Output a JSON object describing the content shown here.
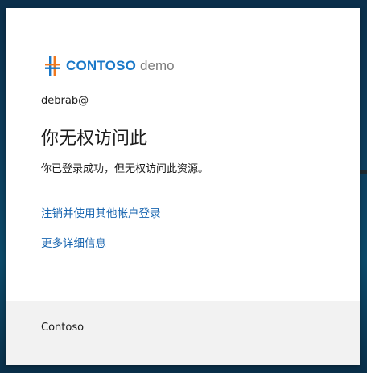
{
  "logo": {
    "brand": "CONTOSO",
    "suffix": "demo",
    "icon": "contoso-logo-icon",
    "colors": {
      "brand": "#1a78c8",
      "accent": "#f0781e"
    }
  },
  "identity": {
    "user": "debrab@"
  },
  "message": {
    "title": "你无权访问此",
    "description": "你已登录成功，但无权访问此资源。"
  },
  "links": {
    "sign_out_other": "注销并使用其他帐户登录",
    "more_details": "更多详细信息"
  },
  "footer": {
    "org": "Contoso"
  }
}
